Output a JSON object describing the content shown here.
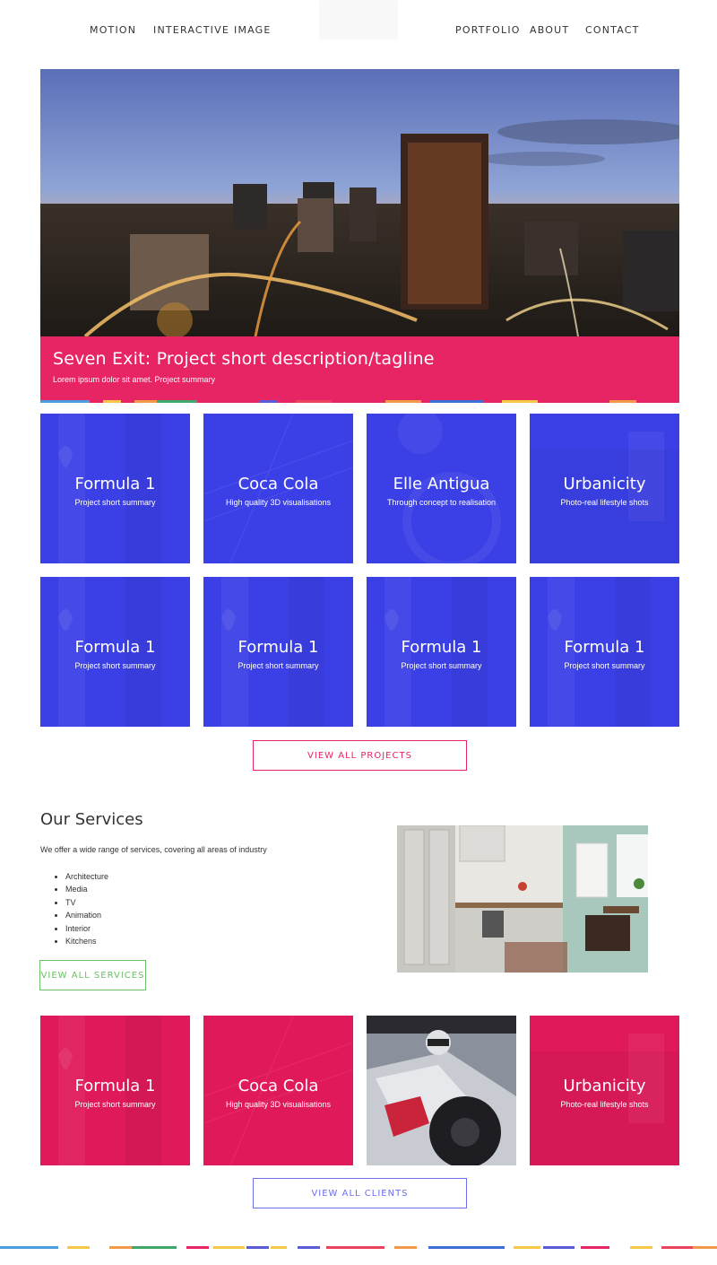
{
  "nav": {
    "left_links": [
      "MOTION",
      "INTERACTIVE",
      "IMAGE"
    ],
    "right_links": [
      "PORTFOLIO",
      "ABOUT",
      "CONTACT"
    ]
  },
  "hero": {
    "title": "Seven Exit: Project short description/tagline",
    "summary": "Lorem ipsum dolor sit amet. Project summary"
  },
  "projects": [
    {
      "title": "Formula 1",
      "summary": "Project short summary"
    },
    {
      "title": "Coca Cola",
      "summary": "High quality 3D visualisations"
    },
    {
      "title": "Elle Antigua",
      "summary": "Through concept to realisation"
    },
    {
      "title": "Urbanicity",
      "summary": "Photo-real lifestyle shots"
    },
    {
      "title": "Formula 1",
      "summary": "Project short summary"
    },
    {
      "title": "Formula 1",
      "summary": "Project short summary"
    },
    {
      "title": "Formula 1",
      "summary": "Project short summary"
    },
    {
      "title": "Formula 1",
      "summary": "Project short summary"
    }
  ],
  "view_all_projects": "VIEW ALL PROJECTS",
  "services": {
    "heading": "Our Services",
    "intro": "We offer a wide range of services, covering all areas of industry",
    "items": [
      "Architecture",
      "Media",
      "TV",
      "Animation",
      "Interior",
      "Kitchens"
    ],
    "button": "VIEW ALL SERVICES"
  },
  "clients": [
    {
      "title": "Formula 1",
      "summary": "Project short summary"
    },
    {
      "title": "Coca Cola",
      "summary": "High quality 3D visualisations"
    },
    {
      "title": "",
      "summary": ""
    },
    {
      "title": "Urbanicity",
      "summary": "Photo-real lifestyle shots"
    }
  ],
  "view_all_clients": "VIEW ALL CLIENTS",
  "colors": {
    "pink": "#e72464",
    "blue": "#3b40e6",
    "client_pink": "#e0195a",
    "green_button": "#6cc066",
    "blue_button": "#6b6ff0"
  }
}
